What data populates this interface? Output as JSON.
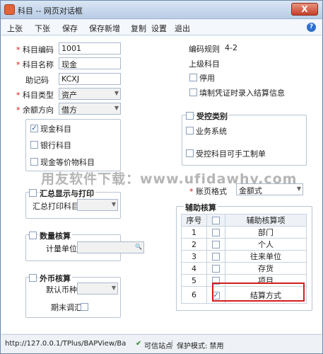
{
  "window": {
    "title": "科目 -- 网页对话框",
    "close_label": "X"
  },
  "toolbar": {
    "buttons": [
      "上张",
      "下张",
      "保存",
      "保存新增",
      "复制",
      "设置",
      "退出"
    ],
    "help_label": "?"
  },
  "form": {
    "code_label": "科目编码",
    "code_value": "1001",
    "name_label": "科目名称",
    "name_value": "现金",
    "mnemonic_label": "助记码",
    "mnemonic_value": "KCXJ",
    "type_label": "科目类型",
    "type_value": "资产",
    "balance_label": "余额方向",
    "balance_value": "借方",
    "cash_label": "现金科目",
    "bank_label": "银行科目",
    "equiv_label": "现金等价物科目"
  },
  "right": {
    "rule_label": "编码规则",
    "rule_value": "4-2",
    "parent_label": "上级科目",
    "disable_label": "停用",
    "settlement_label": "填制凭证时录入结算信息"
  },
  "controlled": {
    "title": "受控类别",
    "business_label": "业务系统",
    "manual_label": "受控科目可手工制单"
  },
  "watermark": "用友软件下载：www.ufidawhy.com",
  "summary": {
    "title": "汇总显示与打印",
    "print_label": "汇总打印科目"
  },
  "page_format": {
    "label": "账页格式",
    "value": "金额式"
  },
  "quantity": {
    "title": "数量核算",
    "unit_label": "计量单位"
  },
  "currency": {
    "title": "外币核算",
    "default_label": "默认币种",
    "adjust_label": "期末调汇"
  },
  "auxiliary": {
    "title": "辅助核算",
    "col_seq": "序号",
    "col_item": "辅助核算项",
    "rows": [
      {
        "seq": "1",
        "item": "部门",
        "checked": false
      },
      {
        "seq": "2",
        "item": "个人",
        "checked": false
      },
      {
        "seq": "3",
        "item": "往来单位",
        "checked": false
      },
      {
        "seq": "4",
        "item": "存货",
        "checked": false
      },
      {
        "seq": "5",
        "item": "项目",
        "checked": false
      },
      {
        "seq": "6",
        "item": "结算方式",
        "checked": true
      }
    ]
  },
  "status": {
    "url": "http://127.0.0.1/TPlus/BAPView/Ba",
    "trust": "可信站点",
    "protect": "保护模式: 禁用"
  }
}
